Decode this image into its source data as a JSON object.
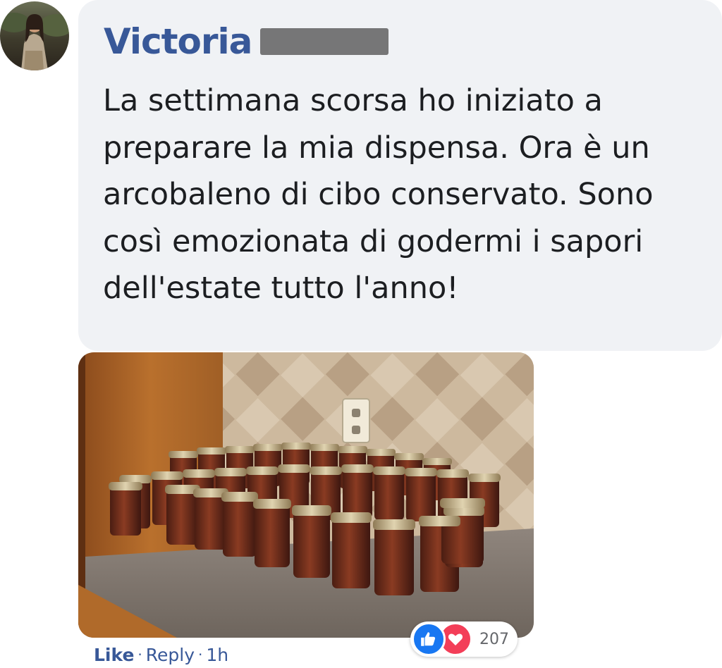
{
  "comment": {
    "author": "Victoria",
    "text": "La settimana scorsa ho iniziato a preparare la mia dispensa. Ora è un arcobaleno di cibo conservato. Sono così emozionata di godermi i sapori dell'estate tutto l'anno!",
    "attachment_icon": "photo-of-canned-jars",
    "actions": {
      "like_label": "Like",
      "separator": "·",
      "reply_label": "Reply",
      "timestamp": "1h"
    },
    "reactions": {
      "types": [
        "like",
        "love"
      ],
      "count": "207"
    }
  },
  "colors": {
    "author_link": "#385898",
    "bubble_bg": "#f0f2f5",
    "like_blue": "#1877f2",
    "love_red": "#f33e58"
  }
}
